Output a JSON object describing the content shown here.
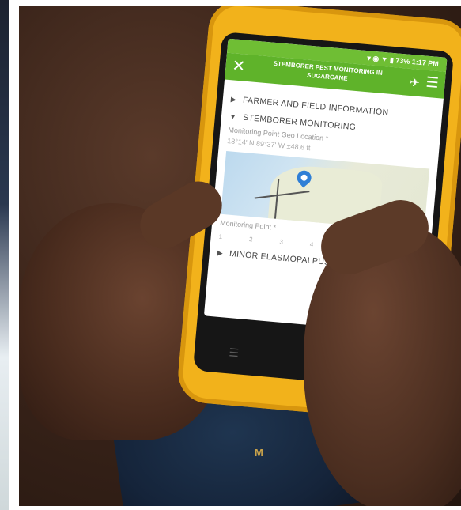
{
  "status_bar": {
    "text": "▾ ◉ ▼ ▮ 73% 1:17 PM"
  },
  "app": {
    "title": "STEMBORER PEST MONITORING IN SUGARCANE",
    "close_glyph": "✕",
    "gps_glyph": "✈",
    "menu_glyph": "☰"
  },
  "form": {
    "sections": [
      {
        "label": "FARMER AND FIELD INFORMATION",
        "expanded": false
      },
      {
        "label": "STEMBORER MONITORING",
        "expanded": true
      },
      {
        "label": "MINOR ELASMOPALPUS (0 Months)",
        "expanded": false
      }
    ],
    "geo_label": "Monitoring Point Geo Location *",
    "geo_value": "18°14' N 89°37' W ±48.6 ft",
    "monitoring_point_label": "Monitoring Point *",
    "slider_ticks": [
      "1",
      "2",
      "3",
      "4"
    ]
  },
  "cloth_text": "M",
  "colors": {
    "phone_body": "#f2b21b",
    "app_bar": "#5fb32a",
    "pin": "#2f7fd6"
  },
  "icons": [
    "close-icon",
    "gps-icon",
    "menu-icon",
    "map-pin-icon",
    "chevron-right-icon",
    "chevron-down-icon"
  ]
}
